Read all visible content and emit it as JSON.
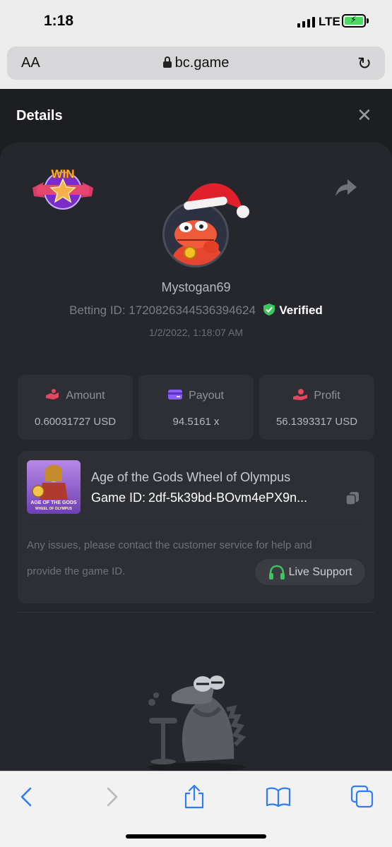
{
  "status_bar": {
    "time": "1:18",
    "network": "LTE"
  },
  "address_bar": {
    "text_size_label": "AA",
    "url": "bc.game"
  },
  "header": {
    "title": "Details",
    "close_icon": "close-icon"
  },
  "badge": {
    "text": "WIN"
  },
  "bet": {
    "username": "Mystogan69",
    "betting_id_label": "Betting ID:",
    "betting_id": "1720826344536394624",
    "verified_label": "Verified",
    "timestamp": "1/2/2022, 1:18:07 AM"
  },
  "stats": [
    {
      "label": "Amount",
      "value": "0.60031727 USD",
      "icon": "amount-icon",
      "color": "#e2475f"
    },
    {
      "label": "Payout",
      "value": "94.5161 x",
      "icon": "payout-card-icon",
      "color": "#8b5cf6"
    },
    {
      "label": "Profit",
      "value": "56.1393317 USD",
      "icon": "profit-icon",
      "color": "#e2475f"
    }
  ],
  "game": {
    "title": "Age of the Gods Wheel of Olympus",
    "id_label": "Game ID:",
    "id": "2df-5k39bd-BOvm4ePX9n...",
    "thumb_line1": "AGE OF THE GODS",
    "thumb_line2": "WHEEL OF OLYMPUS",
    "notice_line1": "Any issues, please contact the customer service for help and",
    "notice_line2": "provide the game ID.",
    "support_label": "Live Support"
  },
  "colors": {
    "accent_green": "#3fc35e",
    "safari_blue": "#2f7cf6",
    "background": "#1d1e22",
    "card": "#2d2f35"
  }
}
